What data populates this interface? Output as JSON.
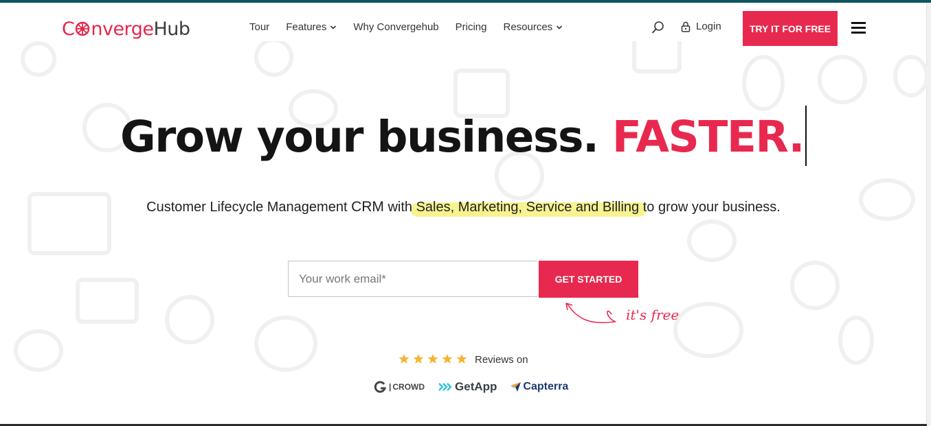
{
  "colors": {
    "accent": "#e8294f",
    "brand_top_bar": "#0e5563",
    "highlight": "#f6f390"
  },
  "logo": {
    "part_a": "C",
    "part_b_pink": "nverge",
    "part_c": "Hub"
  },
  "nav": {
    "tour": "Tour",
    "features": "Features",
    "why": "Why Convergehub",
    "pricing": "Pricing",
    "resources": "Resources"
  },
  "header": {
    "login": "Login",
    "try_button": "TRY IT FOR FREE"
  },
  "hero": {
    "headline_main": "Grow your business.",
    "headline_accent": "FASTER.",
    "sub_start": "Customer Lifecycle Management ",
    "sub_crm": "CRM",
    "sub_with": " with ",
    "sub_highlight": "Sales, Marketing, Service and Billing",
    "sub_end": " to grow your business."
  },
  "signup": {
    "email_placeholder": "Your work email*",
    "button": "GET STARTED",
    "note": "it's free"
  },
  "reviews": {
    "stars": 5,
    "label": "Reviews on",
    "g2_text": "CROWD",
    "getapp": "GetApp",
    "capterra": "Capterra"
  }
}
